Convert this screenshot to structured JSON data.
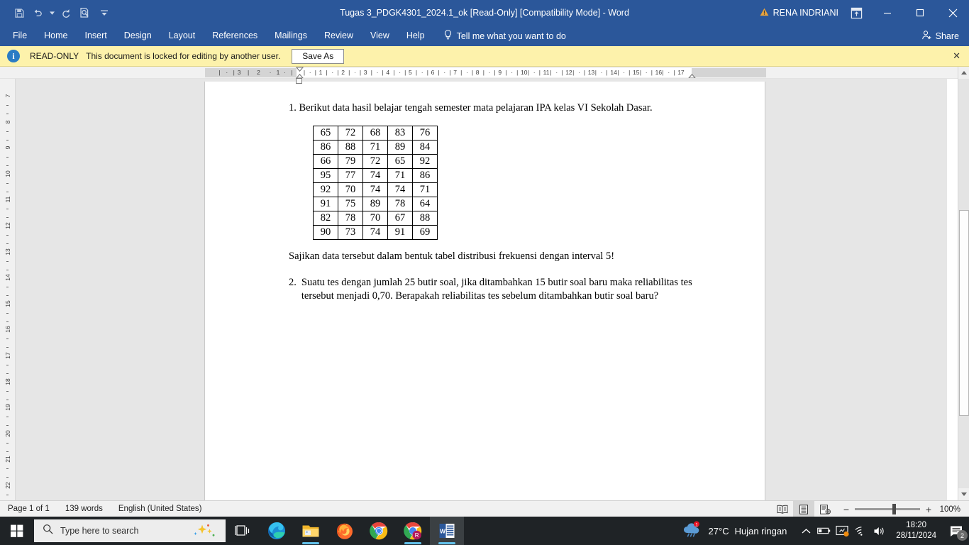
{
  "window": {
    "title": "Tugas 3_PDGK4301_2024.1_ok [Read-Only] [Compatibility Mode]  -  Word",
    "account_name": "RENA INDRIANI",
    "minimize_label": "—",
    "maximize_label": "□",
    "close_label": "✕"
  },
  "quick_access": {
    "save": "save-icon",
    "undo": "undo-icon",
    "redo": "redo-icon",
    "print_preview": "print-preview-icon",
    "customize": "customize-quick-access-icon"
  },
  "ribbon": {
    "tabs": [
      {
        "label": "File"
      },
      {
        "label": "Home"
      },
      {
        "label": "Insert"
      },
      {
        "label": "Design"
      },
      {
        "label": "Layout"
      },
      {
        "label": "References"
      },
      {
        "label": "Mailings"
      },
      {
        "label": "Review"
      },
      {
        "label": "View"
      },
      {
        "label": "Help"
      }
    ],
    "tell_me": "Tell me what you want to do",
    "share": "Share"
  },
  "notice": {
    "badge": "READ-ONLY",
    "message": "This document is locked for editing by another user.",
    "button": "Save As",
    "close": "✕"
  },
  "ruler": {
    "horizontal_left": [
      "3",
      "2",
      "1"
    ],
    "horizontal_right": [
      "1",
      "2",
      "3",
      "4",
      "5",
      "6",
      "7",
      "8",
      "9",
      "10",
      "11",
      "12",
      "13",
      "14",
      "15",
      "16",
      "17"
    ],
    "vertical": [
      "7",
      "8",
      "9",
      "10",
      "11",
      "12",
      "13",
      "14",
      "15",
      "16",
      "17",
      "18",
      "19",
      "20",
      "21",
      "22"
    ]
  },
  "document": {
    "question1": "1. Berikut data hasil belajar tengah semester mata pelajaran IPA kelas VI Sekolah Dasar.",
    "table_rows": [
      [
        "65",
        "72",
        "68",
        "83",
        "76"
      ],
      [
        "86",
        "88",
        "71",
        "89",
        "84"
      ],
      [
        "66",
        "79",
        "72",
        "65",
        "92"
      ],
      [
        "95",
        "77",
        "74",
        "71",
        "86"
      ],
      [
        "92",
        "70",
        "74",
        "74",
        "71"
      ],
      [
        "91",
        "75",
        "89",
        "78",
        "64"
      ],
      [
        "82",
        "78",
        "70",
        "67",
        "88"
      ],
      [
        "90",
        "73",
        "74",
        "91",
        "69"
      ]
    ],
    "instruction": "Sajikan data tersebut dalam bentuk tabel distribusi frekuensi dengan interval 5!",
    "question2_number": "2.",
    "question2_text": "Suatu tes dengan jumlah 25 butir soal, jika ditambahkan 15 butir soal baru maka reliabilitas tes tersebut menjadi 0,70. Berapakah reliabilitas tes sebelum ditambahkan butir soal baru?"
  },
  "status_bar": {
    "page": "Page 1 of 1",
    "words": "139 words",
    "language": "English (United States)",
    "view_read_mode": "read-mode-icon",
    "view_print_layout": "print-layout-icon",
    "view_web_layout": "web-layout-icon",
    "zoom_out": "−",
    "zoom_in": "+",
    "zoom_level": "100%"
  },
  "taskbar": {
    "start": "start-icon",
    "search_placeholder": "Type here to search",
    "task_view": "task-view-icon",
    "apps": [
      {
        "name": "microsoft-edge-icon"
      },
      {
        "name": "file-explorer-icon"
      },
      {
        "name": "firefox-icon"
      },
      {
        "name": "google-chrome-icon"
      },
      {
        "name": "chrome-beta-icon"
      },
      {
        "name": "microsoft-word-icon"
      }
    ],
    "weather_temp": "27°C",
    "weather_desc": "Hujan ringan",
    "time": "18:20",
    "date": "28/11/2024",
    "notification_count": "2"
  },
  "colors": {
    "word_blue": "#2b579a",
    "notice_yellow": "#fdf2ab",
    "taskbar": "#1f2326",
    "accent": "#62c1ea"
  }
}
